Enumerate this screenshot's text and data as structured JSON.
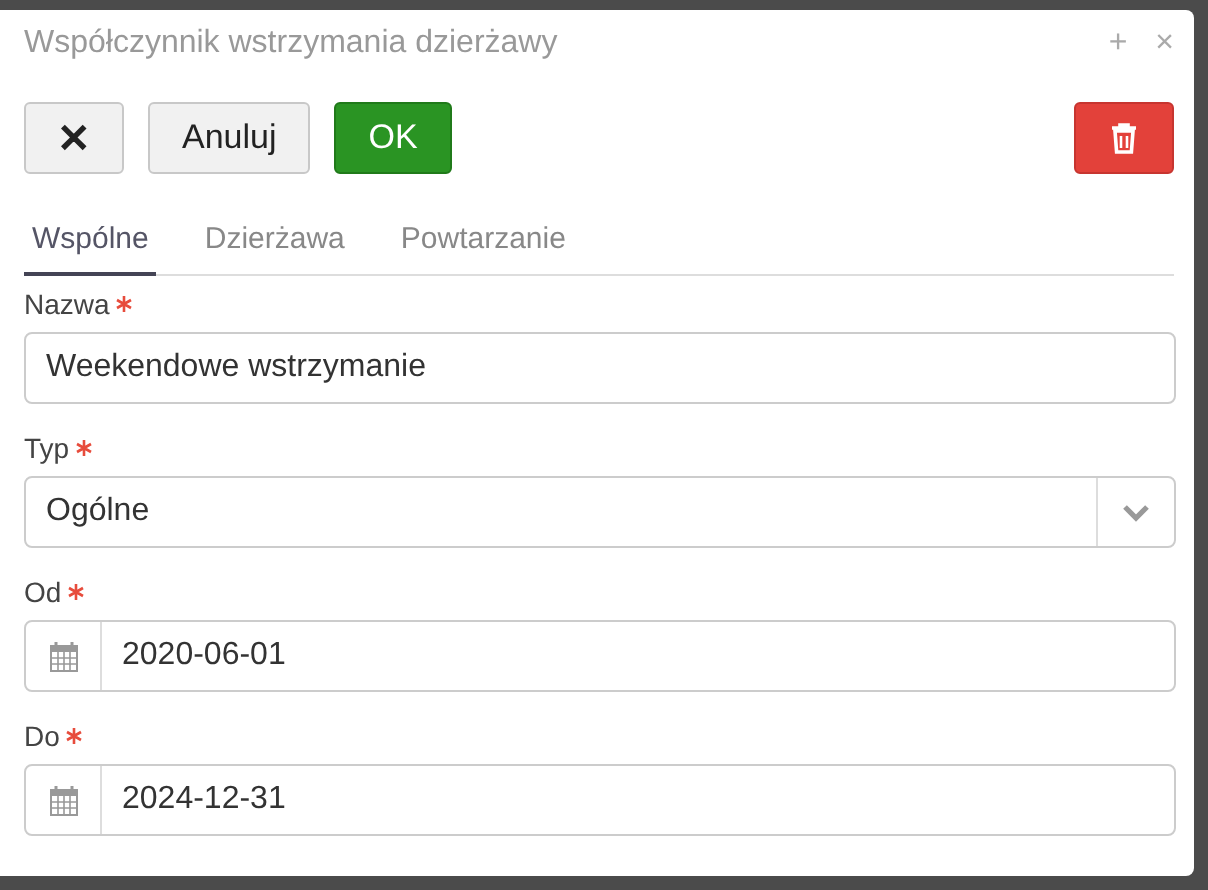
{
  "window": {
    "title": "Współczynnik wstrzymania dzierżawy",
    "controls": [
      "+",
      "×"
    ]
  },
  "toolbar": {
    "buttons": [
      {
        "kind": "close",
        "label": "✕"
      },
      {
        "kind": "cancel",
        "label": "Anuluj"
      },
      {
        "kind": "ok",
        "label": "OK"
      },
      {
        "kind": "delete"
      }
    ]
  },
  "tabs": [
    {
      "label": "Wspólne",
      "selected": true
    },
    {
      "label": "Dzierżawa",
      "selected": false
    },
    {
      "label": "Powtarzanie",
      "selected": false
    }
  ],
  "fields": [
    {
      "kind": "text",
      "label": "Nazwa",
      "required": true,
      "value": "Weekendowe wstrzymanie"
    },
    {
      "kind": "select",
      "label": "Typ",
      "required": true,
      "value": "Ogólne"
    },
    {
      "kind": "date",
      "label": "Od",
      "required": true,
      "value": "2020-06-01"
    },
    {
      "kind": "date",
      "label": "Do",
      "required": true,
      "value": "2024-12-31"
    }
  ]
}
